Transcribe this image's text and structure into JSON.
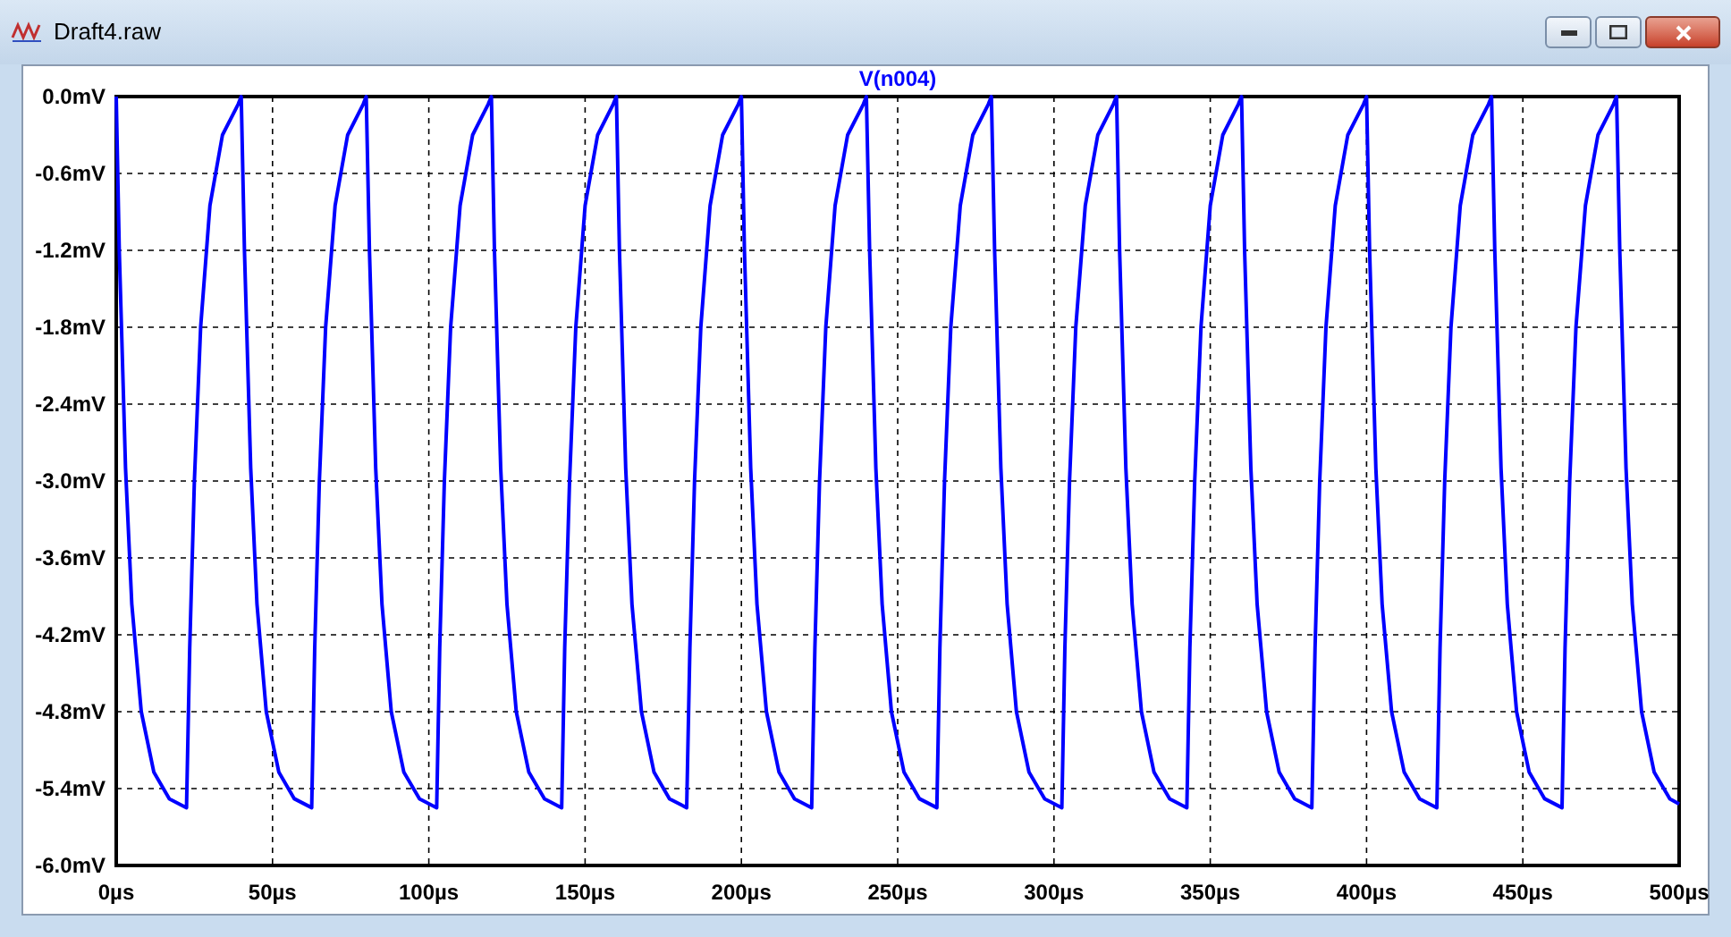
{
  "window": {
    "title": "Draft4.raw"
  },
  "plot": {
    "chart_data": {
      "type": "line",
      "grid": true,
      "x": [
        0,
        1,
        3,
        5,
        8,
        12,
        17,
        22.5,
        23.5,
        25,
        27,
        30,
        34,
        39,
        40,
        41,
        43,
        45,
        48,
        52,
        57,
        62.5,
        63.5,
        65,
        67,
        70,
        74,
        79,
        80,
        81,
        83,
        85,
        88,
        92,
        97,
        102.5,
        103.5,
        105,
        107,
        110,
        114,
        119,
        120,
        121,
        123,
        125,
        128,
        132,
        137,
        142.5,
        143.5,
        145,
        147,
        150,
        154,
        159,
        160,
        161,
        163,
        165,
        168,
        172,
        177,
        182.5,
        183.5,
        185,
        187,
        190,
        194,
        199,
        200,
        201,
        203,
        205,
        208,
        212,
        217,
        222.5,
        223.5,
        225,
        227,
        230,
        234,
        239,
        240,
        241,
        243,
        245,
        248,
        252,
        257,
        262.5,
        263.5,
        265,
        267,
        270,
        274,
        279,
        280,
        281,
        283,
        285,
        288,
        292,
        297,
        302.5,
        303.5,
        305,
        307,
        310,
        314,
        319,
        320,
        321,
        323,
        325,
        328,
        332,
        337,
        342.5,
        343.5,
        345,
        347,
        350,
        354,
        359,
        360,
        361,
        363,
        365,
        368,
        372,
        377,
        382.5,
        383.5,
        385,
        387,
        390,
        394,
        399,
        400,
        401,
        403,
        405,
        408,
        412,
        417,
        422.5,
        423.5,
        425,
        427,
        430,
        434,
        439,
        440,
        441,
        443,
        445,
        448,
        452,
        457,
        462.5,
        463.5,
        465,
        467,
        470,
        474,
        479,
        480,
        481,
        483,
        485,
        488,
        492,
        497,
        500
      ],
      "series": [
        {
          "name": "V(n004)",
          "color": "#0000ff",
          "values": [
            0,
            -1.2,
            -2.9,
            -3.96,
            -4.8,
            -5.27,
            -5.48,
            -5.55,
            -4.3,
            -3.0,
            -1.8,
            -0.85,
            -0.3,
            -0.06,
            0,
            -1.2,
            -2.9,
            -3.96,
            -4.8,
            -5.27,
            -5.48,
            -5.55,
            -4.3,
            -3.0,
            -1.8,
            -0.85,
            -0.3,
            -0.06,
            0,
            -1.2,
            -2.9,
            -3.96,
            -4.8,
            -5.27,
            -5.48,
            -5.55,
            -4.3,
            -3.0,
            -1.8,
            -0.85,
            -0.3,
            -0.06,
            0,
            -1.2,
            -2.9,
            -3.96,
            -4.8,
            -5.27,
            -5.48,
            -5.55,
            -4.3,
            -3.0,
            -1.8,
            -0.85,
            -0.3,
            -0.06,
            0,
            -1.2,
            -2.9,
            -3.96,
            -4.8,
            -5.27,
            -5.48,
            -5.55,
            -4.3,
            -3.0,
            -1.8,
            -0.85,
            -0.3,
            -0.06,
            0,
            -1.2,
            -2.9,
            -3.96,
            -4.8,
            -5.27,
            -5.48,
            -5.55,
            -4.3,
            -3.0,
            -1.8,
            -0.85,
            -0.3,
            -0.06,
            0,
            -1.2,
            -2.9,
            -3.96,
            -4.8,
            -5.27,
            -5.48,
            -5.55,
            -4.3,
            -3.0,
            -1.8,
            -0.85,
            -0.3,
            -0.06,
            0,
            -1.2,
            -2.9,
            -3.96,
            -4.8,
            -5.27,
            -5.48,
            -5.55,
            -4.3,
            -3.0,
            -1.8,
            -0.85,
            -0.3,
            -0.06,
            0,
            -1.2,
            -2.9,
            -3.96,
            -4.8,
            -5.27,
            -5.48,
            -5.55,
            -4.3,
            -3.0,
            -1.8,
            -0.85,
            -0.3,
            -0.06,
            0,
            -1.2,
            -2.9,
            -3.96,
            -4.8,
            -5.27,
            -5.48,
            -5.55,
            -4.3,
            -3.0,
            -1.8,
            -0.85,
            -0.3,
            -0.06,
            0,
            -1.2,
            -2.9,
            -3.96,
            -4.8,
            -5.27,
            -5.48,
            -5.55,
            -4.3,
            -3.0,
            -1.8,
            -0.85,
            -0.3,
            -0.06,
            0,
            -1.2,
            -2.9,
            -3.96,
            -4.8,
            -5.27,
            -5.48,
            -5.55,
            -4.3,
            -3.0,
            -1.8,
            -0.85,
            -0.3,
            -0.06,
            0,
            -1.2,
            -2.9,
            -3.96,
            -4.8,
            -5.27,
            -5.48,
            -5.52
          ]
        }
      ],
      "xlim": [
        0,
        500
      ],
      "ylim": [
        -6,
        0
      ],
      "xticks": [
        {
          "value": 0,
          "label": "0µs"
        },
        {
          "value": 50,
          "label": "50µs"
        },
        {
          "value": 100,
          "label": "100µs"
        },
        {
          "value": 150,
          "label": "150µs"
        },
        {
          "value": 200,
          "label": "200µs"
        },
        {
          "value": 250,
          "label": "250µs"
        },
        {
          "value": 300,
          "label": "300µs"
        },
        {
          "value": 350,
          "label": "350µs"
        },
        {
          "value": 400,
          "label": "400µs"
        },
        {
          "value": 450,
          "label": "450µs"
        },
        {
          "value": 500,
          "label": "500µs"
        }
      ],
      "yticks": [
        {
          "value": 0,
          "label": "0.0mV"
        },
        {
          "value": -0.6,
          "label": "-0.6mV"
        },
        {
          "value": -1.2,
          "label": "-1.2mV"
        },
        {
          "value": -1.8,
          "label": "-1.8mV"
        },
        {
          "value": -2.4,
          "label": "-2.4mV"
        },
        {
          "value": -3.0,
          "label": "-3.0mV"
        },
        {
          "value": -3.6,
          "label": "-3.6mV"
        },
        {
          "value": -4.2,
          "label": "-4.2mV"
        },
        {
          "value": -4.8,
          "label": "-4.8mV"
        },
        {
          "value": -5.4,
          "label": "-5.4mV"
        },
        {
          "value": -6.0,
          "label": "-6.0mV"
        }
      ]
    }
  }
}
